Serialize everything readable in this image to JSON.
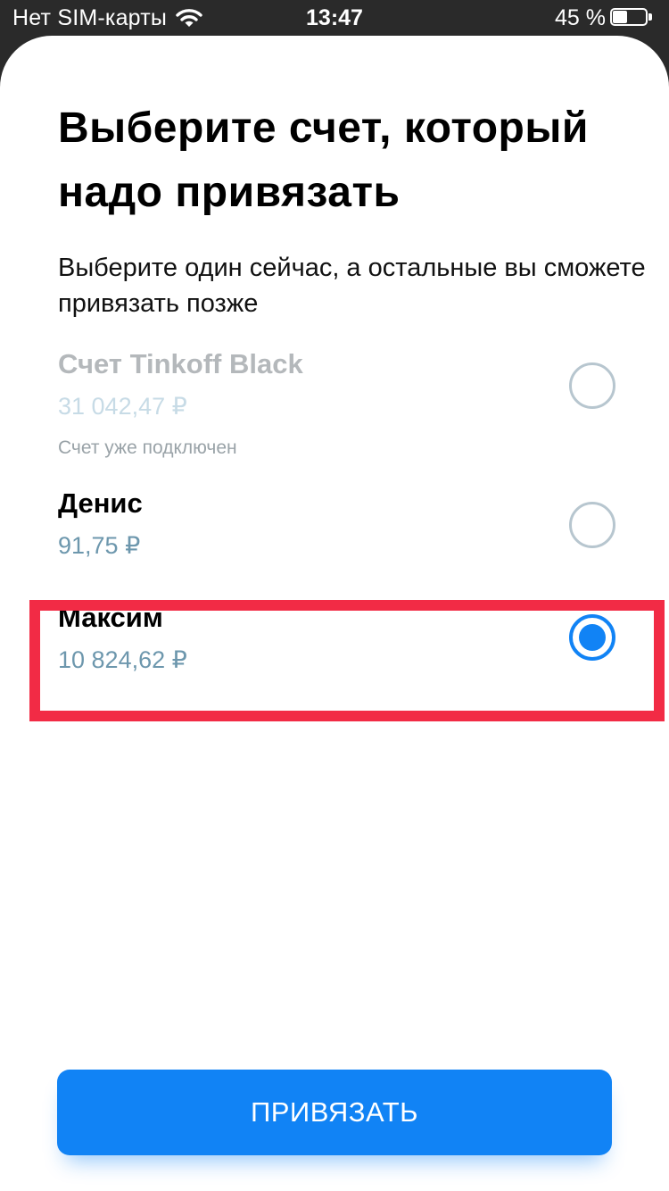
{
  "status_bar": {
    "carrier": "Нет SIM-карты",
    "time": "13:47",
    "battery_percent": "45 %",
    "battery_level": 0.45
  },
  "sheet": {
    "title": "Выберите счет, который надо привязать",
    "subtitle": "Выберите один сейчас, а остальные вы сможете привязать позже"
  },
  "accounts": [
    {
      "name": "Счет Tinkoff Black",
      "balance": "31 042,47 ₽",
      "note": "Счет уже подключен",
      "state": "disabled",
      "selected": false
    },
    {
      "name": "Денис",
      "balance": "91,75 ₽",
      "state": "enabled",
      "selected": false
    },
    {
      "name": "Максим",
      "balance": "10 824,62 ₽",
      "state": "enabled",
      "selected": true
    }
  ],
  "primary_button": {
    "label": "ПРИВЯЗАТЬ"
  },
  "colors": {
    "accent": "#1183f5",
    "highlight": "#f22b45",
    "balance": "#6d97ad",
    "disabled_text": "#b4b8bb"
  },
  "icons": {
    "wifi": "wifi-icon",
    "battery": "battery-icon",
    "radio": "radio-button-icon"
  }
}
